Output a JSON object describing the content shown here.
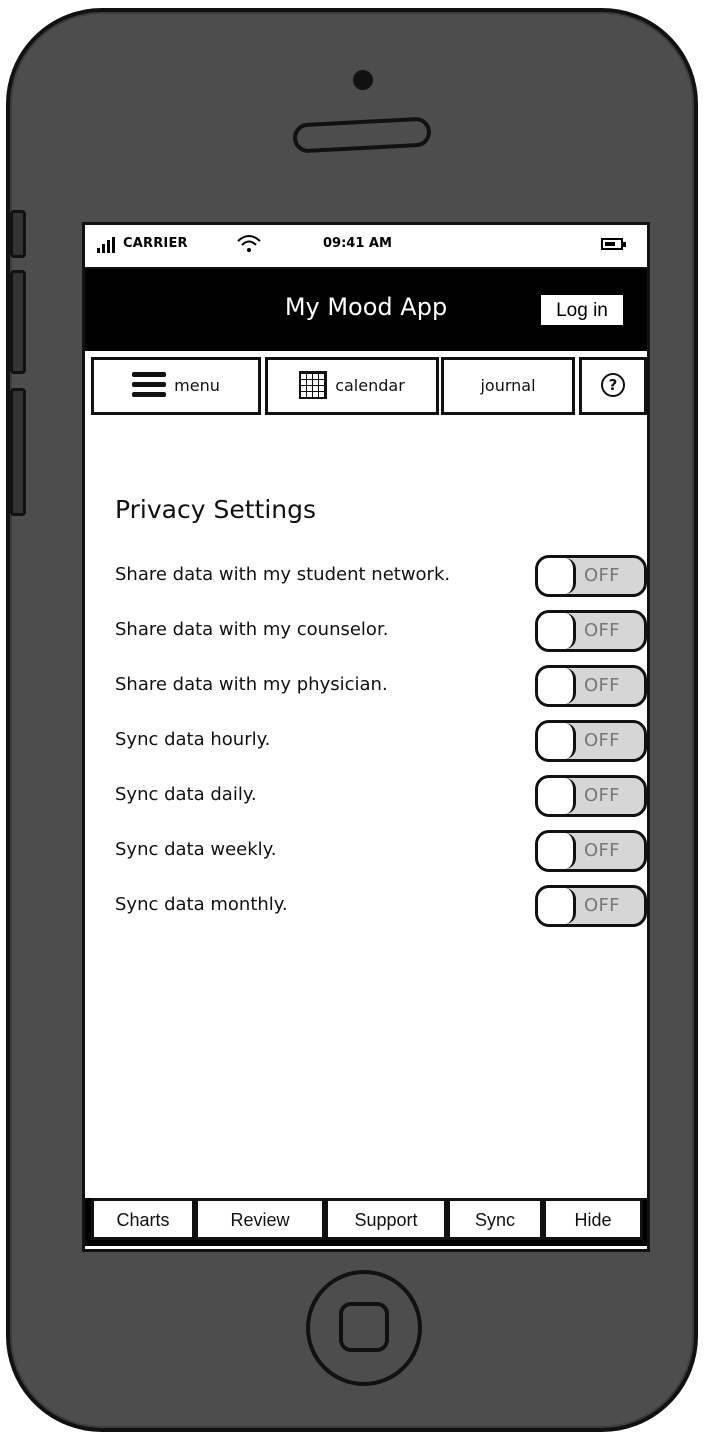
{
  "status_bar": {
    "carrier": "CARRIER",
    "time": "09:41 AM",
    "signal_icon": "signal-icon",
    "wifi_icon": "wifi-icon",
    "battery_icon": "battery-icon"
  },
  "header": {
    "title": "My Mood App",
    "login_label": "Log in"
  },
  "tabs": {
    "items": [
      {
        "label": "menu",
        "icon": "hamburger-menu-icon"
      },
      {
        "label": "calendar",
        "icon": "calendar-icon"
      },
      {
        "label": "journal"
      },
      {
        "label": "?",
        "icon": "help-icon"
      }
    ]
  },
  "privacy": {
    "title": "Privacy Settings",
    "items": [
      {
        "label": "Share data with my student network.",
        "state": "OFF"
      },
      {
        "label": "Share data with my counselor.",
        "state": "OFF"
      },
      {
        "label": "Share data with my physician.",
        "state": "OFF"
      },
      {
        "label": "Sync data hourly.",
        "state": "OFF"
      },
      {
        "label": "Sync data daily.",
        "state": "OFF"
      },
      {
        "label": "Sync data weekly.",
        "state": "OFF"
      },
      {
        "label": "Sync data monthly.",
        "state": "OFF"
      }
    ]
  },
  "bottom_tabs": {
    "items": [
      {
        "label": "Charts"
      },
      {
        "label": "Review"
      },
      {
        "label": "Support"
      },
      {
        "label": "Sync"
      },
      {
        "label": "Hide"
      }
    ]
  },
  "colors": {
    "phone_body": "#4d4d4d",
    "header_background": "#000000",
    "toggle_off_background": "#d6d6d6",
    "toggle_off_text": "#777777"
  }
}
